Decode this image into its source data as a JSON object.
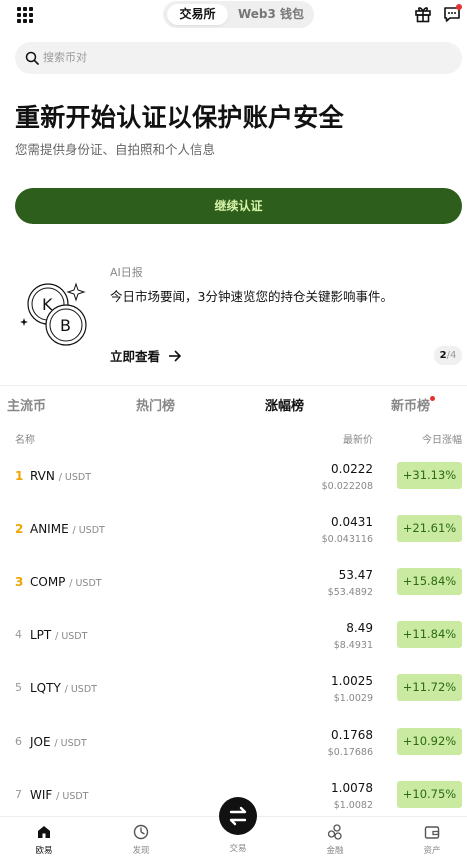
{
  "header": {
    "tabs": [
      "交易所",
      "Web3 钱包"
    ],
    "active_tab": 0
  },
  "search": {
    "placeholder": "搜索币对"
  },
  "hero": {
    "title": "重新开始认证以保护账户安全",
    "subtitle": "您需提供身份证、自拍照和个人信息",
    "cta_label": "继续认证"
  },
  "ai_card": {
    "tag": "AI日报",
    "text": "今日市场要闻，3分钟速览您的持仓关键影响事件。",
    "link_label": "立即查看",
    "pager_current": "2",
    "pager_total": "/4"
  },
  "market_tabs": [
    "主流币",
    "热门榜",
    "涨幅榜",
    "新币榜"
  ],
  "active_market_tab": 2,
  "columns": {
    "name": "名称",
    "price": "最新价",
    "change": "今日涨幅"
  },
  "rows": [
    {
      "rank": "1",
      "base": "RVN",
      "quote": "/ USDT",
      "price": "0.0222",
      "price_usd": "$0.022208",
      "change": "+31.13%"
    },
    {
      "rank": "2",
      "base": "ANIME",
      "quote": "/ USDT",
      "price": "0.0431",
      "price_usd": "$0.043116",
      "change": "+21.61%"
    },
    {
      "rank": "3",
      "base": "COMP",
      "quote": "/ USDT",
      "price": "53.47",
      "price_usd": "$53.4892",
      "change": "+15.84%"
    },
    {
      "rank": "4",
      "base": "LPT",
      "quote": "/ USDT",
      "price": "8.49",
      "price_usd": "$8.4931",
      "change": "+11.84%"
    },
    {
      "rank": "5",
      "base": "LQTY",
      "quote": "/ USDT",
      "price": "1.0025",
      "price_usd": "$1.0029",
      "change": "+11.72%"
    },
    {
      "rank": "6",
      "base": "JOE",
      "quote": "/ USDT",
      "price": "0.1768",
      "price_usd": "$0.17686",
      "change": "+10.92%"
    },
    {
      "rank": "7",
      "base": "WIF",
      "quote": "/ USDT",
      "price": "1.0078",
      "price_usd": "$1.0082",
      "change": "+10.75%"
    }
  ],
  "bottom_nav": [
    "欧易",
    "发现",
    "交易",
    "金融",
    "资产"
  ],
  "colors": {
    "accent": "#2e5e1b",
    "positive_bg": "#c9eaa0",
    "positive_text": "#2d6a14",
    "rank_top": "#f0a500",
    "alert": "#e5312f"
  }
}
